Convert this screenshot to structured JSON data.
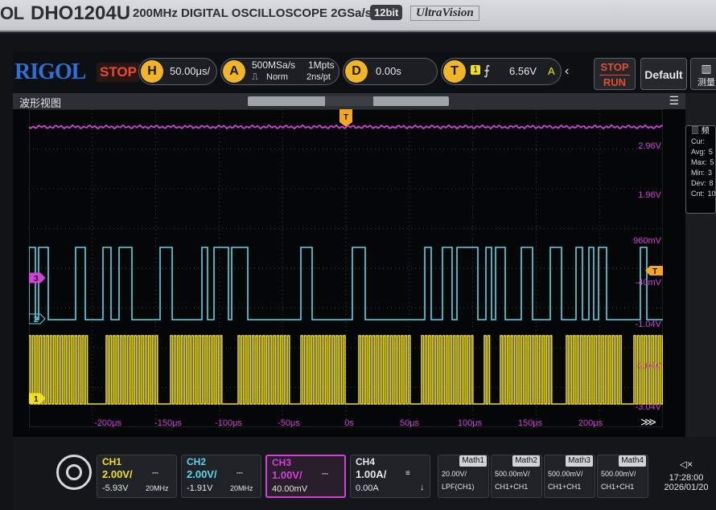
{
  "bezel": {
    "brand": "OL",
    "model": "DHO1204U",
    "description": "200MHz DIGITAL OSCILLOSCOPE 2GSa/s",
    "bit_badge": "12bit",
    "series": "UltraVision"
  },
  "topbar": {
    "logo": "RIGOL",
    "run_state": "STOP",
    "horizontal": {
      "key": "H",
      "value": "50.00μs/"
    },
    "acquire": {
      "key": "A",
      "sample_rate": "500MSa/s",
      "mode": "Norm",
      "memory": "1Mpts",
      "resolution": "2ns/pt"
    },
    "delay": {
      "key": "D",
      "value": "0.00s"
    },
    "trigger": {
      "key": "T",
      "source": "1",
      "level": "6.56V",
      "mode": "A"
    },
    "stop_run": {
      "top": "STOP",
      "bottom": "RUN"
    },
    "default_label": "Default",
    "measure_label": "测量"
  },
  "window": {
    "title": "波形视图",
    "menu_icon": "☰",
    "trigger_marker": "T"
  },
  "plot": {
    "y_labels": [
      "2.96V",
      "1.96V",
      "960mV",
      "-40mV",
      "-1.04V",
      "-2.04V",
      "-3.04V"
    ],
    "x_labels": [
      "-200μs",
      "-150μs",
      "-100μs",
      "-50μs",
      "0s",
      "50μs",
      "100μs",
      "150μs",
      "200μs"
    ],
    "markers": {
      "ch1": "1",
      "ch2": "2",
      "ch3": "3",
      "trigger": "T"
    },
    "colors": {
      "ch1": "#f2e21b",
      "ch2": "#5ad7e8",
      "ch3": "#d240d8",
      "grid": "#4a4e52",
      "trigger": "#f5a623"
    }
  },
  "measure_panel": {
    "header": "频",
    "rows": [
      {
        "label": "Cur:",
        "value": ""
      },
      {
        "label": "Avg:",
        "value": "5"
      },
      {
        "label": "Max:",
        "value": "5"
      },
      {
        "label": "Min:",
        "value": "3"
      },
      {
        "label": "Dev:",
        "value": "8"
      },
      {
        "label": "Cnt:",
        "value": "10"
      }
    ]
  },
  "channels": [
    {
      "name": "CH1",
      "scale": "2.00V/",
      "offset": "-5.93V",
      "bw": "20MHz",
      "color": "#f2e21b"
    },
    {
      "name": "CH2",
      "scale": "2.00V/",
      "offset": "-1.91V",
      "bw": "20MHz",
      "color": "#5ad7e8"
    },
    {
      "name": "CH3",
      "scale": "1.00V/",
      "offset": "40.00mV",
      "bw": "",
      "color": "#d240d8"
    },
    {
      "name": "CH4",
      "scale": "1.00A/",
      "offset": "0.00A",
      "bw": "",
      "color": "#e6e6e6"
    }
  ],
  "math": [
    {
      "name": "Math1",
      "line1": "20.00V/",
      "line2": "LPF(CH1)"
    },
    {
      "name": "Math2",
      "line1": "500.00mV/",
      "line2": "CH1+CH1"
    },
    {
      "name": "Math3",
      "line1": "500.00mV/",
      "line2": "CH1+CH1"
    },
    {
      "name": "Math4",
      "line1": "500.00mV/",
      "line2": "CH1+CH1"
    }
  ],
  "clock": {
    "time": "17:28:00",
    "date": "2026/01/20"
  }
}
